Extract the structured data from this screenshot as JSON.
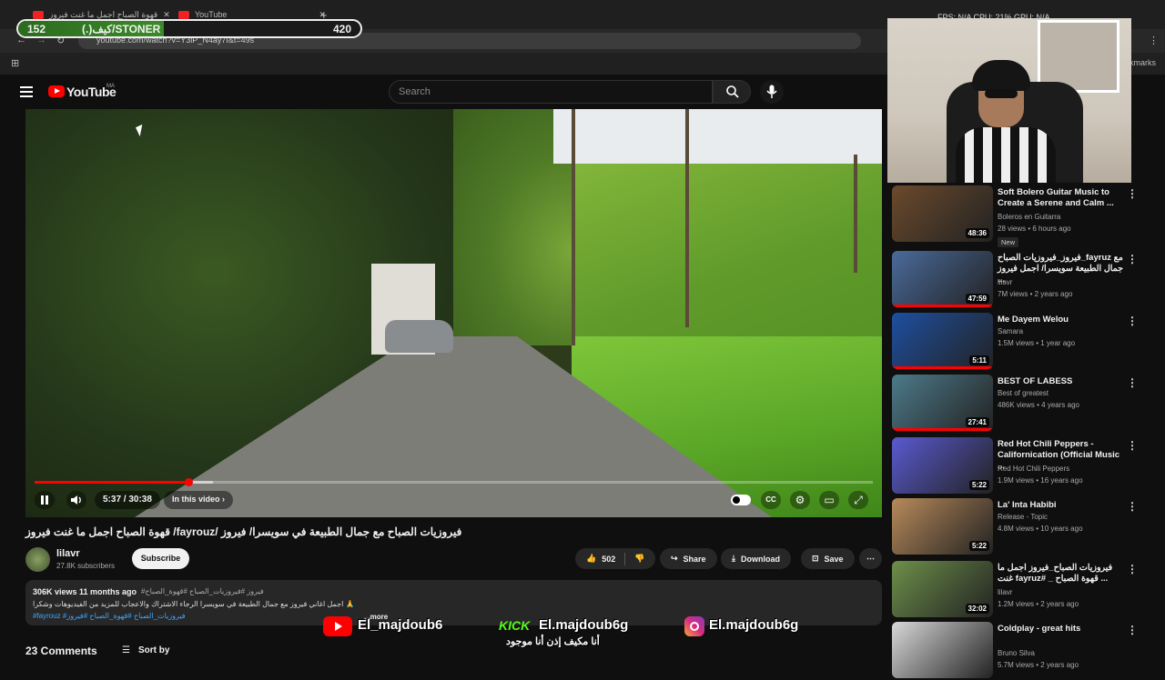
{
  "browser": {
    "tab1_title": "قهوة الصباح اجمل ما غنت فيروز",
    "tab2_title": "YouTube",
    "new_tab": "+",
    "url": "youtube.com/watch?v=Y3lP_N4ay7I&t=49s",
    "bookmarks_label": "bookmarks"
  },
  "overlay": {
    "left_value": "152",
    "label": "(.)كيف/STONER",
    "right_value": "420"
  },
  "stats_text": "FPS: N/A    CPU: 21%    GPU: N/A",
  "header": {
    "logo_text": "YouTube",
    "logo_region": "MA",
    "search_placeholder": "Search"
  },
  "player": {
    "time": "5:37 / 30:38",
    "chapter_label": "In this video",
    "progress_fraction": 0.183
  },
  "video": {
    "title": "قهوة الصباح اجمل ما غنت فيروز /fayrouz/ فيروزيات الصباح مع جمال الطبيعة في سويسرا/ فيروز",
    "channel_name": "lilavr",
    "subscribers": "27.8K subscribers",
    "subscribe_label": "Subscribe",
    "likes": "502",
    "share_label": "Share",
    "download_label": "Download",
    "save_label": "Save",
    "views": "306K views  11 months ago",
    "hashtags_top": "#فيروز #فيروزيات_الصباح #قهوة_الصباح",
    "desc_line": "اجمل اغاني فيروز مع جمال الطبيعة في سويسرا الرجاء الاشتراك والاعجاب للمزيد من الفيديوهات وشكرا 🙏",
    "hashtags_bottom": "#fayrouz #فيروزيات_الصباح #قهوة_الصباح #فيروز",
    "more_label": "...more",
    "comments_label": "23 Comments",
    "sort_label": "Sort by"
  },
  "socials": {
    "youtube_handle": "El_majdoub6",
    "kick_brand": "KICK",
    "kick_handle": "El.majdoub6g",
    "instagram_handle": "El.majdoub6g",
    "tagline": "أنا مكيف إذن أنا موجود"
  },
  "sidebar": [
    {
      "title": "Soft Bolero Guitar Music to Create a Serene and Calm ...",
      "channel": "Boleros en Guitarra",
      "meta": "28 views • 6 hours ago",
      "badge": "New",
      "duration": "48:36",
      "thumb": "#6b4a2c",
      "watched": 0
    },
    {
      "title": "فيروز_فيروزيات الصباح_fayruz مع جمال الطبيعة سويسرا/ اجمل فيروز ...",
      "channel": "lilavr",
      "meta": "7M views • 2 years ago",
      "duration": "47:59",
      "thumb": "#4a6a9a",
      "watched": 1
    },
    {
      "title": "Me Dayem Welou",
      "channel": "Samara",
      "meta": "1.5M views • 1 year ago",
      "duration": "5:11",
      "thumb": "#1e4fa0",
      "watched": 1
    },
    {
      "title": "BEST OF LABESS",
      "channel": "Best of greatest",
      "meta": "486K views • 4 years ago",
      "duration": "27:41",
      "thumb": "#4d7a8a",
      "watched": 1
    },
    {
      "title": "Red Hot Chili Peppers - Californication (Official Music ...",
      "channel": "Red Hot Chili Peppers",
      "meta": "1.9M views • 16 years ago",
      "duration": "5:22",
      "thumb": "#5a5ad0",
      "watched": 0
    },
    {
      "title": "La' Inta Habibi",
      "channel": "Release - Topic",
      "meta": "4.8M views • 10 years ago",
      "duration": "5:22",
      "thumb": "#b78a5a",
      "watched": 0
    },
    {
      "title": "فيروزيات الصباح_فيروز اجمل ما غنت fayruz# _ قهوة الصباح ...",
      "channel": "lilavr",
      "meta": "1.2M views • 2 years ago",
      "duration": "32:02",
      "thumb": "#6d8f4a",
      "watched": 0
    },
    {
      "title": "Coldplay - great hits",
      "channel": "Bruno Silva",
      "meta": "5.7M views • 2 years ago",
      "duration": "",
      "thumb": "#d8d8d8",
      "watched": 0
    }
  ],
  "colors": {
    "accent": "#ff0000",
    "background": "#0f0f0f",
    "kick": "#53fc18",
    "link": "#3ea6ff"
  },
  "icons": [
    "menu-icon",
    "search-icon",
    "mic-icon",
    "pause-icon",
    "volume-icon",
    "autoplay-toggle",
    "captions-icon",
    "settings-icon",
    "miniplayer-icon",
    "fullscreen-icon",
    "like-icon",
    "dislike-icon",
    "share-icon",
    "download-icon",
    "save-icon",
    "more-icon",
    "sort-icon",
    "cursor-icon"
  ]
}
